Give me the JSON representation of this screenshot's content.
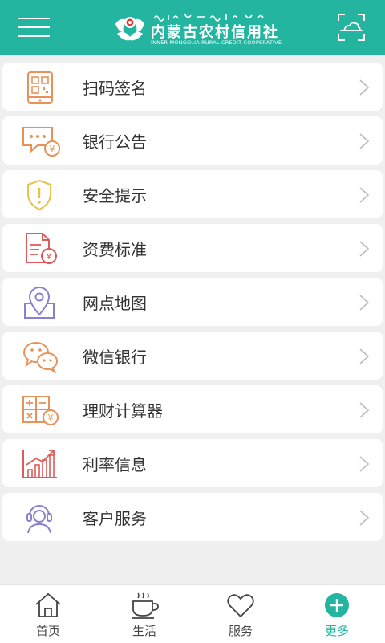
{
  "header": {
    "logo_script": "ᠮᠣᠩᠭᠣᠯ",
    "logo_title": "内蒙古农村信用社",
    "logo_subtitle": "INNER MONGOLIA RURAL CREDIT COOPERATIVE",
    "icons": {
      "menu": "hamburger-icon",
      "scan": "scan-icon"
    }
  },
  "menu": {
    "items": [
      {
        "label": "扫码签名",
        "icon": "qr-sign-icon",
        "color": "#e8925a"
      },
      {
        "label": "银行公告",
        "icon": "announcement-icon",
        "color": "#e8925a"
      },
      {
        "label": "安全提示",
        "icon": "shield-warning-icon",
        "color": "#e8c34a"
      },
      {
        "label": "资费标准",
        "icon": "fee-document-icon",
        "color": "#e05a5a"
      },
      {
        "label": "网点地图",
        "icon": "map-pin-icon",
        "color": "#8b7fcf"
      },
      {
        "label": "微信银行",
        "icon": "wechat-icon",
        "color": "#e8925a"
      },
      {
        "label": "理财计算器",
        "icon": "calculator-icon",
        "color": "#e8925a"
      },
      {
        "label": "利率信息",
        "icon": "rate-chart-icon",
        "color": "#e05a5a"
      },
      {
        "label": "客户服务",
        "icon": "customer-service-icon",
        "color": "#8b7fcf"
      }
    ]
  },
  "tabbar": {
    "tabs": [
      {
        "label": "首页",
        "icon": "home-icon"
      },
      {
        "label": "生活",
        "icon": "coffee-cup-icon"
      },
      {
        "label": "服务",
        "icon": "heart-icon"
      },
      {
        "label": "更多",
        "icon": "plus-circle-icon",
        "active": true
      }
    ],
    "accent": "#23b5a0"
  }
}
